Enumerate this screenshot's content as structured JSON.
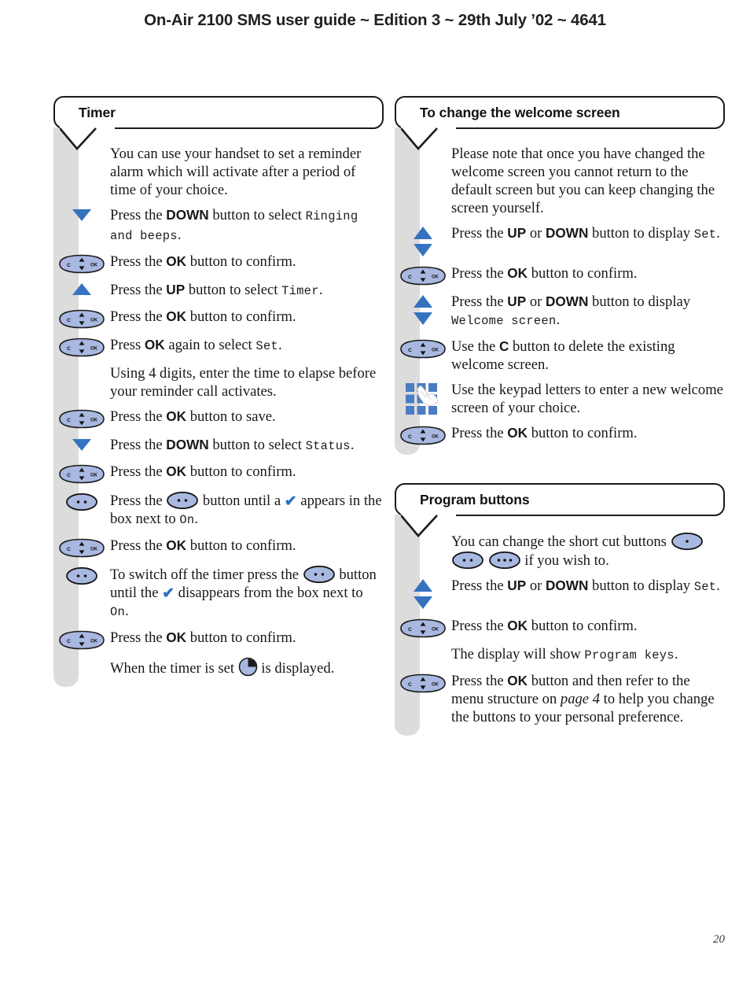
{
  "running_head": "On-Air 2100 SMS user guide ~ Edition 3 ~ 29th July ’02 ~ 4641",
  "page_number": "20",
  "colors": {
    "accent_blue": "#3573c0",
    "button_fill": "#a8b8e0",
    "rail_grey": "#dcdcdc",
    "outline": "#1b1b1b",
    "keypad_blue": "#4a7cc4",
    "text": "#181818"
  },
  "left_column": {
    "sections": [
      {
        "title": "Timer",
        "rows": [
          {
            "icon": "none",
            "text_parts": [
              {
                "t": "You can use your handset to set a reminder alarm which will activate after a period of time of your choice.",
                "s": "plain"
              }
            ]
          },
          {
            "icon": "arrow-down",
            "text_parts": [
              {
                "t": "Press the ",
                "s": "plain"
              },
              {
                "t": "DOWN",
                "s": "bold"
              },
              {
                "t": " button to select ",
                "s": "plain"
              },
              {
                "t": "Ringing and beeps",
                "s": "lcd"
              },
              {
                "t": ".",
                "s": "plain"
              }
            ]
          },
          {
            "icon": "nav-button",
            "text_parts": [
              {
                "t": "Press the ",
                "s": "plain"
              },
              {
                "t": "OK",
                "s": "bold"
              },
              {
                "t": " button to confirm.",
                "s": "plain"
              }
            ]
          },
          {
            "icon": "arrow-up",
            "text_parts": [
              {
                "t": "Press the ",
                "s": "plain"
              },
              {
                "t": "UP",
                "s": "bold"
              },
              {
                "t": " button to select ",
                "s": "plain"
              },
              {
                "t": "Timer",
                "s": "lcd"
              },
              {
                "t": ".",
                "s": "plain"
              }
            ]
          },
          {
            "icon": "nav-button",
            "text_parts": [
              {
                "t": "Press the ",
                "s": "plain"
              },
              {
                "t": "OK",
                "s": "bold"
              },
              {
                "t": " button to confirm.",
                "s": "plain"
              }
            ]
          },
          {
            "icon": "nav-button",
            "text_parts": [
              {
                "t": "Press ",
                "s": "plain"
              },
              {
                "t": "OK",
                "s": "bold"
              },
              {
                "t": " again to select ",
                "s": "plain"
              },
              {
                "t": "Set",
                "s": "lcd"
              },
              {
                "t": ".",
                "s": "plain"
              }
            ]
          },
          {
            "icon": "none",
            "text_parts": [
              {
                "t": "Using 4 digits, enter the time to elapse before your reminder call activates.",
                "s": "plain"
              }
            ]
          },
          {
            "icon": "nav-button",
            "text_parts": [
              {
                "t": "Press the ",
                "s": "plain"
              },
              {
                "t": "OK",
                "s": "bold"
              },
              {
                "t": " button to save.",
                "s": "plain"
              }
            ]
          },
          {
            "icon": "arrow-down",
            "text_parts": [
              {
                "t": "Press the ",
                "s": "plain"
              },
              {
                "t": "DOWN",
                "s": "bold"
              },
              {
                "t": " button to select ",
                "s": "plain"
              },
              {
                "t": "Status",
                "s": "lcd"
              },
              {
                "t": ".",
                "s": "plain"
              }
            ]
          },
          {
            "icon": "nav-button",
            "text_parts": [
              {
                "t": "Press the ",
                "s": "plain"
              },
              {
                "t": "OK",
                "s": "bold"
              },
              {
                "t": " button to confirm.",
                "s": "plain"
              }
            ]
          },
          {
            "icon": "shortcut-2",
            "text_parts": [
              {
                "t": "Press the ",
                "s": "plain"
              },
              {
                "t": "",
                "s": "shortcut-2-inline"
              },
              {
                "t": " button until a ",
                "s": "plain"
              },
              {
                "t": "✔",
                "s": "tick"
              },
              {
                "t": " appears in the box next to ",
                "s": "plain"
              },
              {
                "t": "On",
                "s": "lcd"
              },
              {
                "t": ".",
                "s": "plain"
              }
            ]
          },
          {
            "icon": "nav-button",
            "text_parts": [
              {
                "t": "Press the ",
                "s": "plain"
              },
              {
                "t": "OK",
                "s": "bold"
              },
              {
                "t": " button to confirm.",
                "s": "plain"
              }
            ]
          },
          {
            "icon": "shortcut-2",
            "text_parts": [
              {
                "t": "To switch off the timer press the ",
                "s": "plain"
              },
              {
                "t": "",
                "s": "shortcut-2-inline"
              },
              {
                "t": " button until the ",
                "s": "plain"
              },
              {
                "t": "✔",
                "s": "tick"
              },
              {
                "t": " disappears from the box next to ",
                "s": "plain"
              },
              {
                "t": "On",
                "s": "lcd"
              },
              {
                "t": ".",
                "s": "plain"
              }
            ]
          },
          {
            "icon": "nav-button",
            "text_parts": [
              {
                "t": "Press the ",
                "s": "plain"
              },
              {
                "t": "OK",
                "s": "bold"
              },
              {
                "t": " button to confirm.",
                "s": "plain"
              }
            ]
          },
          {
            "icon": "none",
            "text_parts": [
              {
                "t": "When the timer is set ",
                "s": "plain"
              },
              {
                "t": "",
                "s": "clock-inline"
              },
              {
                "t": " is displayed.",
                "s": "plain"
              }
            ]
          }
        ]
      }
    ]
  },
  "right_column": {
    "sections": [
      {
        "title": "To change the welcome screen",
        "rows": [
          {
            "icon": "none",
            "text_parts": [
              {
                "t": "Please note that once you have changed the welcome screen you cannot return to the default screen but you can keep changing the screen yourself.",
                "s": "plain"
              }
            ]
          },
          {
            "icon": "arrow-pair",
            "text_parts": [
              {
                "t": "Press the ",
                "s": "plain"
              },
              {
                "t": "UP",
                "s": "bold"
              },
              {
                "t": " or ",
                "s": "plain"
              },
              {
                "t": "DOWN",
                "s": "bold"
              },
              {
                "t": " button to display ",
                "s": "plain"
              },
              {
                "t": "Set",
                "s": "lcd"
              },
              {
                "t": ".",
                "s": "plain"
              }
            ]
          },
          {
            "icon": "nav-button",
            "text_parts": [
              {
                "t": "Press the ",
                "s": "plain"
              },
              {
                "t": "OK",
                "s": "bold"
              },
              {
                "t": " button to confirm.",
                "s": "plain"
              }
            ]
          },
          {
            "icon": "arrow-pair",
            "text_parts": [
              {
                "t": "Press the ",
                "s": "plain"
              },
              {
                "t": "UP",
                "s": "bold"
              },
              {
                "t": " or ",
                "s": "plain"
              },
              {
                "t": "DOWN",
                "s": "bold"
              },
              {
                "t": " button to display ",
                "s": "plain"
              },
              {
                "t": "Welcome screen",
                "s": "lcd"
              },
              {
                "t": ".",
                "s": "plain"
              }
            ]
          },
          {
            "icon": "nav-button",
            "text_parts": [
              {
                "t": "Use the ",
                "s": "plain"
              },
              {
                "t": "C",
                "s": "bold"
              },
              {
                "t": " button to delete the existing welcome screen.",
                "s": "plain"
              }
            ]
          },
          {
            "icon": "keypad",
            "text_parts": [
              {
                "t": "Use the keypad letters to enter a new welcome screen of your choice.",
                "s": "plain"
              }
            ]
          },
          {
            "icon": "nav-button",
            "text_parts": [
              {
                "t": "Press the ",
                "s": "plain"
              },
              {
                "t": "OK",
                "s": "bold"
              },
              {
                "t": " button to confirm.",
                "s": "plain"
              }
            ]
          }
        ]
      },
      {
        "title": "Program buttons",
        "rows": [
          {
            "icon": "none",
            "text_parts": [
              {
                "t": "You can change the short cut buttons ",
                "s": "plain"
              },
              {
                "t": "",
                "s": "shortcut-1-inline"
              },
              {
                "t": " ",
                "s": "plain"
              },
              {
                "t": "",
                "s": "shortcut-2-inline"
              },
              {
                "t": " ",
                "s": "plain"
              },
              {
                "t": "",
                "s": "shortcut-3-inline"
              },
              {
                "t": " if you wish to.",
                "s": "plain"
              }
            ]
          },
          {
            "icon": "arrow-pair",
            "text_parts": [
              {
                "t": "Press the ",
                "s": "plain"
              },
              {
                "t": "UP",
                "s": "bold"
              },
              {
                "t": " or ",
                "s": "plain"
              },
              {
                "t": "DOWN",
                "s": "bold"
              },
              {
                "t": " button to display ",
                "s": "plain"
              },
              {
                "t": "Set",
                "s": "lcd"
              },
              {
                "t": ".",
                "s": "plain"
              }
            ]
          },
          {
            "icon": "nav-button",
            "text_parts": [
              {
                "t": "Press the ",
                "s": "plain"
              },
              {
                "t": "OK",
                "s": "bold"
              },
              {
                "t": " button to confirm.",
                "s": "plain"
              }
            ]
          },
          {
            "icon": "none",
            "text_parts": [
              {
                "t": "The display will show ",
                "s": "plain"
              },
              {
                "t": "Program keys",
                "s": "lcd"
              },
              {
                "t": ".",
                "s": "plain"
              }
            ]
          },
          {
            "icon": "nav-button",
            "text_parts": [
              {
                "t": "Press the ",
                "s": "plain"
              },
              {
                "t": "OK",
                "s": "bold"
              },
              {
                "t": " button and then refer to the menu structure on ",
                "s": "plain"
              },
              {
                "t": "page 4",
                "s": "italic"
              },
              {
                "t": " to help you change the buttons to your personal preference.",
                "s": "plain"
              }
            ]
          }
        ]
      }
    ]
  },
  "icon_names": {
    "arrow-up": "arrow-up-icon",
    "arrow-down": "arrow-down-icon",
    "arrow-pair": "arrow-up-down-icon",
    "nav-button": "navigation-ok-c-button-icon",
    "shortcut-1": "shortcut-button-one-dot-icon",
    "shortcut-2": "shortcut-button-two-dot-icon",
    "shortcut-3": "shortcut-button-three-dot-icon",
    "keypad": "keypad-hand-icon",
    "clock": "clock-icon"
  }
}
